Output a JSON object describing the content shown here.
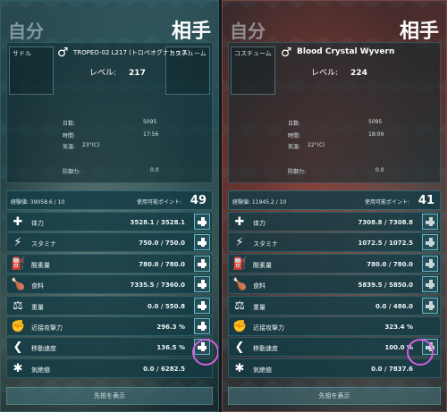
{
  "left": {
    "header_self": "自分",
    "header_other": "相手",
    "saddle_slot_label": "サドル",
    "costume_slot_label": "コスチューム",
    "gender_symbol": "♂",
    "name": "TROPEO-02 L217 (トロペオグナトゥス)",
    "level_label": "レベル:",
    "level_value": "217",
    "age_label": "日数:",
    "age_value": "5095",
    "time_label": "時間:",
    "time_value": "17:56",
    "temp_label": "気温:",
    "temp_value": "23°(C)",
    "armor_label": "防御力:",
    "armor_value": "0.0",
    "xp": "経験値: 39058.6 / 10",
    "points_label": "使用可能ポイント:",
    "points_value": "49",
    "stats": [
      {
        "icon": "health-icon",
        "glyph": "✚",
        "label": "体力",
        "value": "3528.1 / 3528.1"
      },
      {
        "icon": "stamina-icon",
        "glyph": "⚡",
        "label": "スタミナ",
        "value": "750.0 / 750.0"
      },
      {
        "icon": "oxygen-icon",
        "glyph": "⛽",
        "label": "酸素量",
        "value": "780.0 / 780.0"
      },
      {
        "icon": "food-icon",
        "glyph": "🍗",
        "label": "食料",
        "value": "7335.5 / 7360.0"
      },
      {
        "icon": "weight-icon",
        "glyph": "⚖",
        "label": "重量",
        "value": "0.0 / 550.8"
      },
      {
        "icon": "melee-icon",
        "glyph": "✊",
        "label": "近接攻撃力",
        "value": "296.3 %"
      },
      {
        "icon": "speed-icon",
        "glyph": "❮",
        "label": "移動速度",
        "value": "136.5 %"
      },
      {
        "icon": "torpor-icon",
        "glyph": "✱",
        "label": "気絶値",
        "value": "0.0 / 6282.5"
      }
    ],
    "ancestry_button": "先祖を表示"
  },
  "right": {
    "header_self": "自分",
    "header_other": "相手",
    "costume_slot_label": "コスチューム",
    "gender_symbol": "♂",
    "name": "Blood Crystal Wyvern",
    "level_label": "レベル:",
    "level_value": "224",
    "age_label": "日数:",
    "age_value": "5095",
    "time_label": "時間:",
    "time_value": "18:09",
    "temp_label": "気温:",
    "temp_value": "22°(C)",
    "armor_label": "防御力:",
    "armor_value": "0.0",
    "xp": "経験値: 11945.2 / 10",
    "points_label": "使用可能ポイント:",
    "points_value": "41",
    "stats": [
      {
        "icon": "health-icon",
        "glyph": "✚",
        "label": "体力",
        "value": "7308.8 / 7308.8"
      },
      {
        "icon": "stamina-icon",
        "glyph": "⚡",
        "label": "スタミナ",
        "value": "1072.5 / 1072.5"
      },
      {
        "icon": "oxygen-icon",
        "glyph": "⛽",
        "label": "酸素量",
        "value": "780.0 / 780.0"
      },
      {
        "icon": "food-icon",
        "glyph": "🍗",
        "label": "食料",
        "value": "5839.5 / 5850.0"
      },
      {
        "icon": "weight-icon",
        "glyph": "⚖",
        "label": "重量",
        "value": "0.0 / 486.0"
      },
      {
        "icon": "melee-icon",
        "glyph": "✊",
        "label": "近接攻撃力",
        "value": "323.4 %"
      },
      {
        "icon": "speed-icon",
        "glyph": "❮",
        "label": "移動速度",
        "value": "100.0 %"
      },
      {
        "icon": "torpor-icon",
        "glyph": "✱",
        "label": "気絶値",
        "value": "0.0 / 7837.6"
      }
    ],
    "ancestry_button": "先祖を表示"
  },
  "colors": {
    "highlight_ring": "#d35fe0",
    "left_border": "#2f5c66",
    "right_border": "#7a4640"
  }
}
